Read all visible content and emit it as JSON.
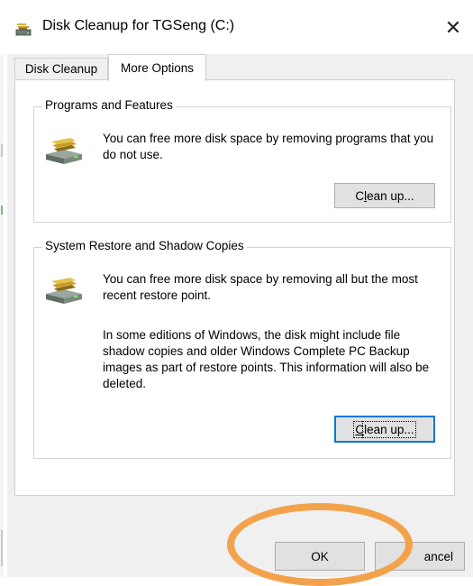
{
  "window": {
    "title": "Disk Cleanup for TGSeng (C:)",
    "close_glyph": "✕"
  },
  "tabs": [
    {
      "label": "Disk Cleanup",
      "active": false
    },
    {
      "label": "More Options",
      "active": true
    }
  ],
  "programs_group": {
    "label": "Programs and Features",
    "description": "You can free more disk space by removing programs that you do not use.",
    "button": {
      "mnemonic": "l",
      "prefix": "C",
      "suffix": "ean up..."
    }
  },
  "restore_group": {
    "label": "System Restore and Shadow Copies",
    "description": "You can free more disk space by removing all but the most recent restore point.",
    "note": "In some editions of Windows, the disk might include file shadow copies and older Windows Complete PC Backup images as part of restore points. This information will also be deleted.",
    "button": {
      "mnemonic": "C",
      "suffix": "lean up..."
    }
  },
  "footer": {
    "ok_label": "OK",
    "cancel_label": "ancel"
  },
  "icons": {
    "title": "disk-cleanup-icon",
    "group": "drive-cleanup-icon",
    "close": "close-icon"
  },
  "colors": {
    "annotation": "#f3a24c",
    "focus_border": "#0078d7"
  }
}
